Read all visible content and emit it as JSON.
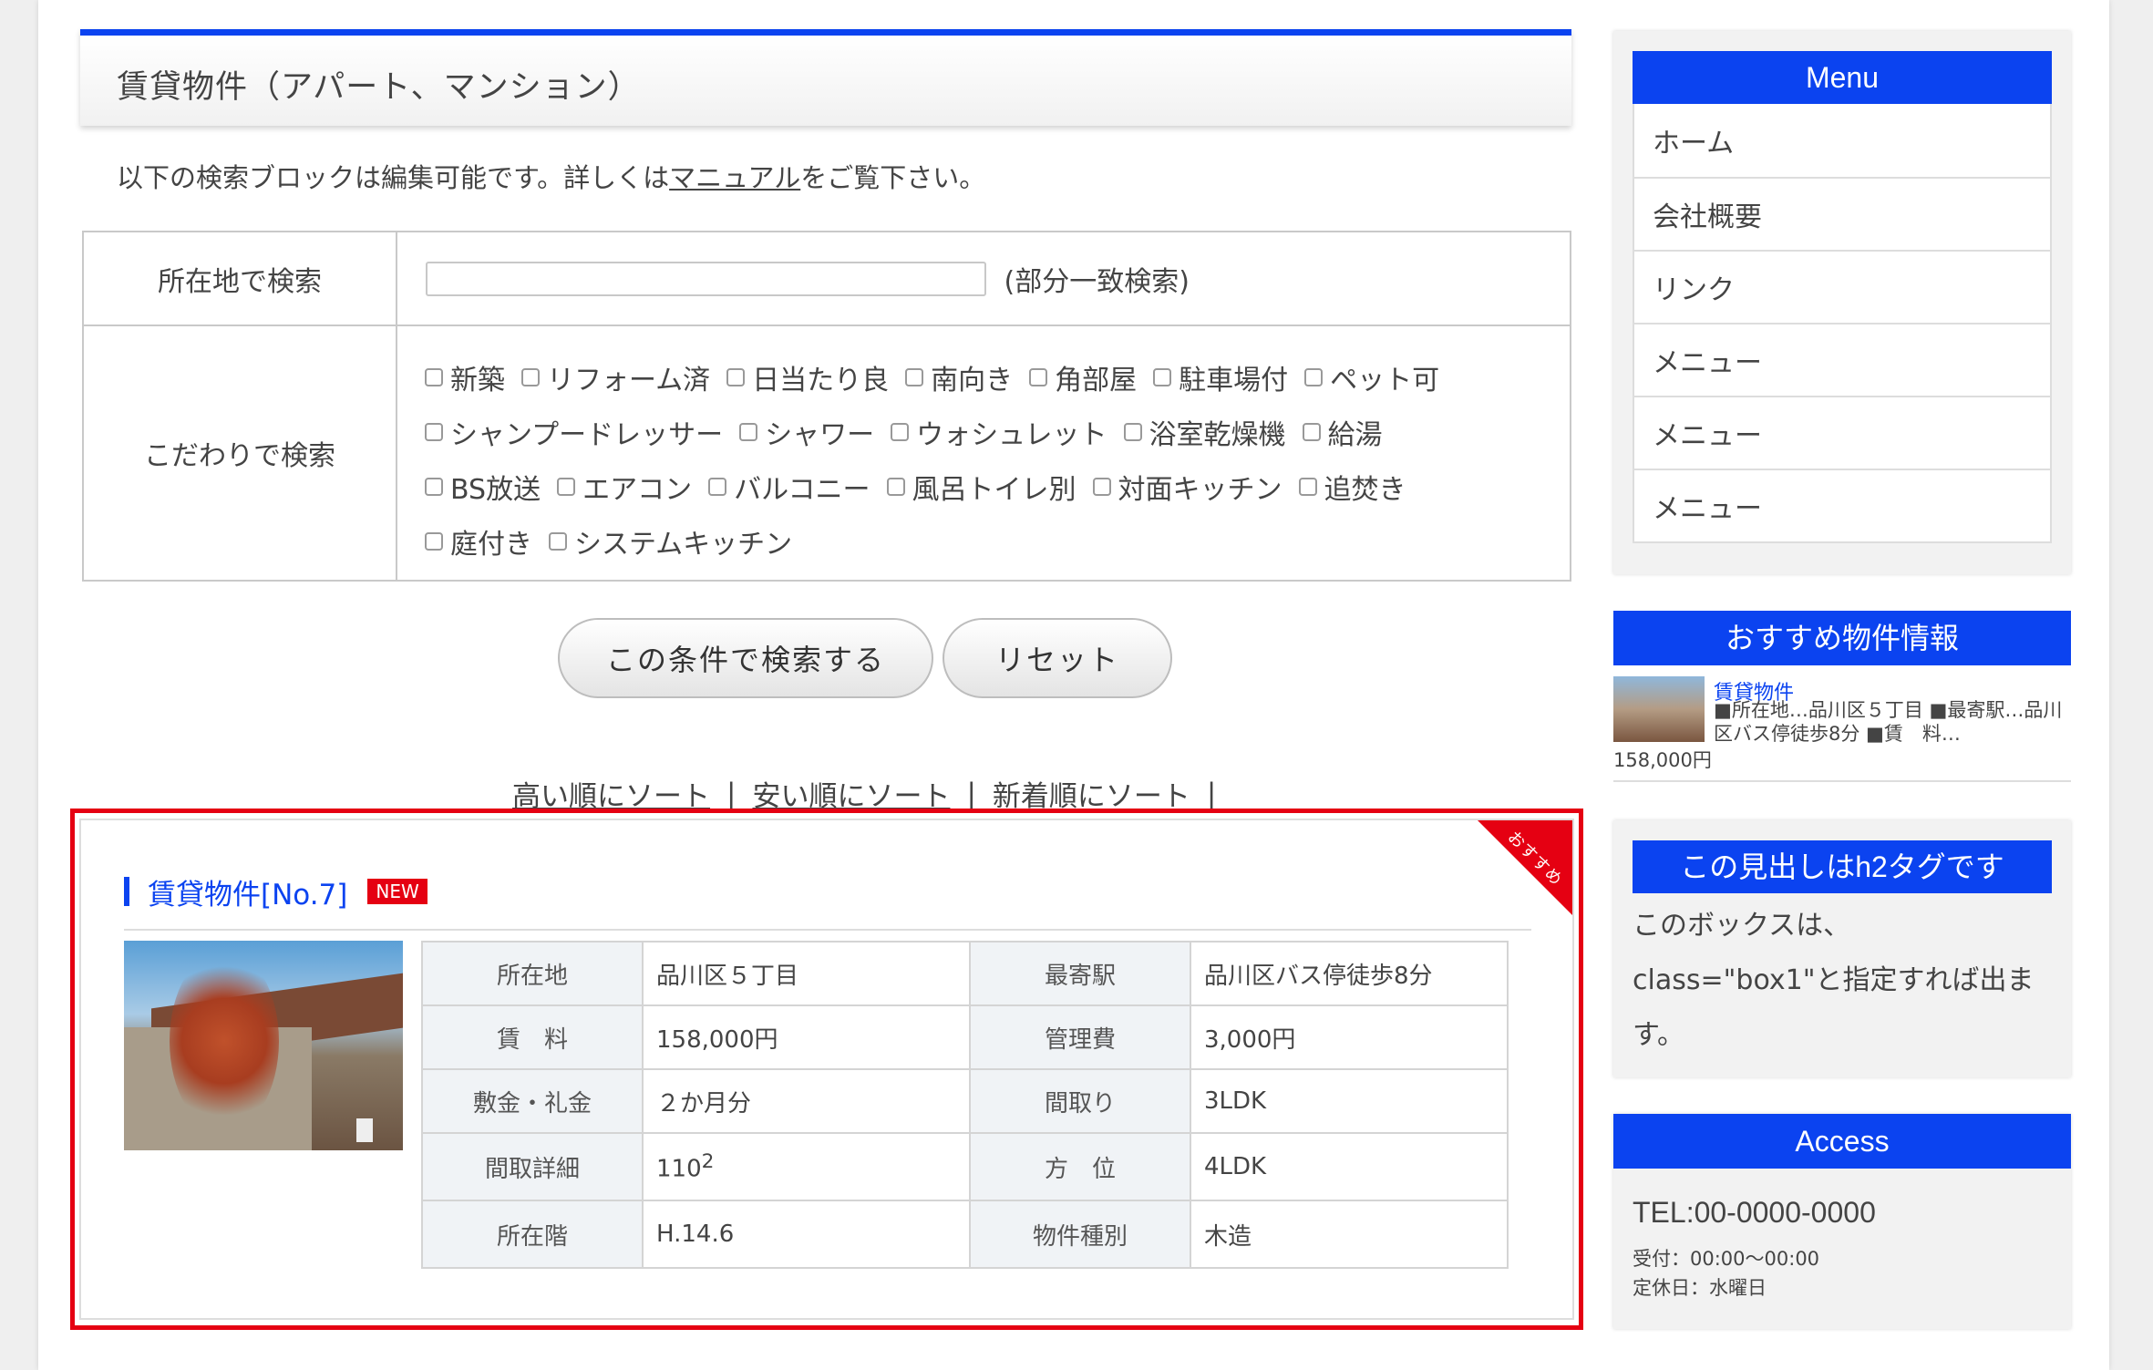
{
  "main": {
    "title": "賃貸物件（アパート、マンション）",
    "intro_before": "以下の検索ブロックは編集可能です。詳しくは",
    "intro_link": "マニュアル",
    "intro_after": "をご覧下さい。"
  },
  "search": {
    "location_label": "所在地で検索",
    "location_value": "",
    "partial_match": "(部分一致検索)",
    "features_label": "こだわりで検索",
    "feature_rows": [
      [
        "新築",
        "リフォーム済",
        "日当たり良",
        "南向き",
        "角部屋",
        "駐車場付",
        "ペット可"
      ],
      [
        "シャンプードレッサー",
        "シャワー",
        "ウォシュレット",
        "浴室乾燥機",
        "給湯"
      ],
      [
        "BS放送",
        "エアコン",
        "バルコニー",
        "風呂トイレ別",
        "対面キッチン",
        "追焚き"
      ],
      [
        "庭付き",
        "システムキッチン"
      ]
    ],
    "search_button": "この条件で検索する",
    "reset_button": "リセット"
  },
  "sort": {
    "high": "高い順にソート",
    "low": "安い順にソート",
    "newest": "新着順にソート",
    "separator": "|"
  },
  "property": {
    "ribbon": "おすすめ",
    "title": "賃貸物件[No.7]",
    "badge": "NEW",
    "rows": [
      {
        "k1": "所在地",
        "v1": "品川区５丁目",
        "k2": "最寄駅",
        "v2": "品川区バス停徒歩8分"
      },
      {
        "k1": "賃　料",
        "v1": "158,000円",
        "k2": "管理費",
        "v2": "3,000円"
      },
      {
        "k1": "敷金・礼金",
        "v1": "２か月分",
        "k2": "間取り",
        "v2": "3LDK"
      },
      {
        "k1": "間取詳細",
        "v1": "110",
        "v1_sup": "2",
        "k2": "方　位",
        "v2": "4LDK"
      },
      {
        "k1": "所在階",
        "v1": "H.14.6",
        "k2": "物件種別",
        "v2": "木造"
      }
    ]
  },
  "sidebar": {
    "menu_title": "Menu",
    "menu_items": [
      "ホーム",
      "会社概要",
      "リンク",
      "メニュー",
      "メニュー",
      "メニュー"
    ],
    "recommend": {
      "title": "おすすめ物件情報",
      "item_title": "賃貸物件",
      "item_desc": "■所在地…品川区５丁目 ■最寄駅…品川区バス停徒歩8分 ■賃　料…",
      "item_price": "158,000円"
    },
    "box": {
      "title": "この見出しはh2タグです",
      "text": "このボックスは、class=\"box1\"と指定すれば出ます。"
    },
    "access": {
      "title": "Access",
      "tel": "TEL:00-0000-0000",
      "hours": "受付：00:00〜00:00",
      "closed": "定休日：水曜日"
    }
  },
  "colors": {
    "accent": "#0b43f0",
    "highlight_border": "#e50012",
    "badge": "#e50012"
  }
}
